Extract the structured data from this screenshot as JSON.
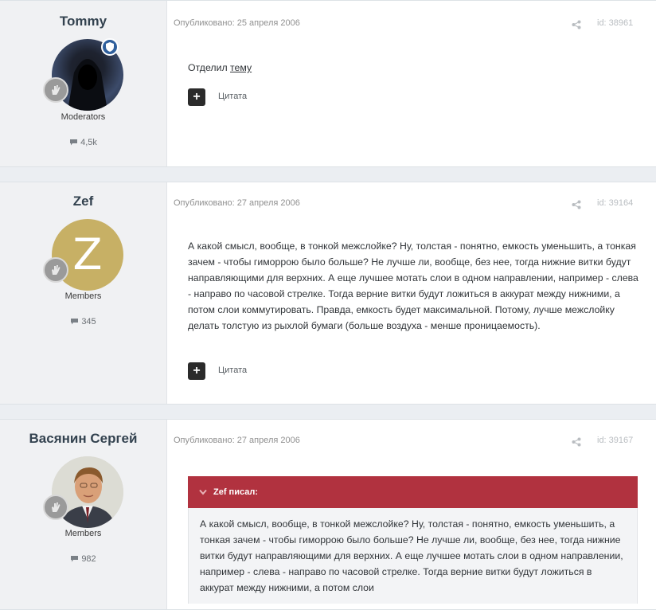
{
  "posts": [
    {
      "author": "Tommy",
      "group": "Moderators",
      "count": "4,5k",
      "meta": "Опубликовано: 25 апреля 2006",
      "id": "id: 38961",
      "content_prefix": "Отделил ",
      "content_link": "тему",
      "quote_label": "Цитата"
    },
    {
      "author": "Zef",
      "avatar_letter": "Z",
      "group": "Members",
      "count": "345",
      "meta": "Опубликовано: 27 апреля 2006",
      "id": "id: 39164",
      "content": "А какой смысл, вообще, в тонкой межслойке? Ну, толстая - понятно, емкость уменьшить, а тонкая зачем - чтобы гиморрою было больше? Не лучше ли, вообще, без нее, тогда нижние витки будут направляющими для верхних. А еще лучшее мотать слои в одном направлении, например - слева - направо по часовой стрелке. Тогда верние витки будут ложиться в аккурат между нижними, а потом слои коммутировать. Правда, емкость будет максимальной. Потому, лучше межслойку делать толстую из рыхлой бумаги (больше воздуха - менше проницаемость).",
      "quote_label": "Цитата"
    },
    {
      "author": "Васянин Сергей",
      "group": "Members",
      "count": "982",
      "meta": "Опубликовано: 27 апреля 2006",
      "id": "id: 39167",
      "citation_author": "Zef писал:",
      "citation_text": "А какой смысл, вообще, в тонкой межслойке? Ну, толстая - понятно, емкость уменьшить, а тонкая зачем - чтобы гиморрою было больше? Не лучше ли, вообще, без нее, тогда нижние витки будут направляющими для верхних. А еще лучшее мотать слои в одном направлении, например - слева - направо по часовой стрелке. Тогда верние витки будут ложиться в аккурат между нижними, а потом слои"
    }
  ],
  "colors": {
    "citation_header": "#b1323f",
    "zef_avatar": "#c7b065",
    "moderator_badge": "#2f5f9c"
  },
  "icons": {
    "rank": "hand-badge-icon",
    "comments": "speech-bubble-icon",
    "share": "share-icon",
    "quote": "plus-icon",
    "citation": "chevron-down-icon"
  }
}
